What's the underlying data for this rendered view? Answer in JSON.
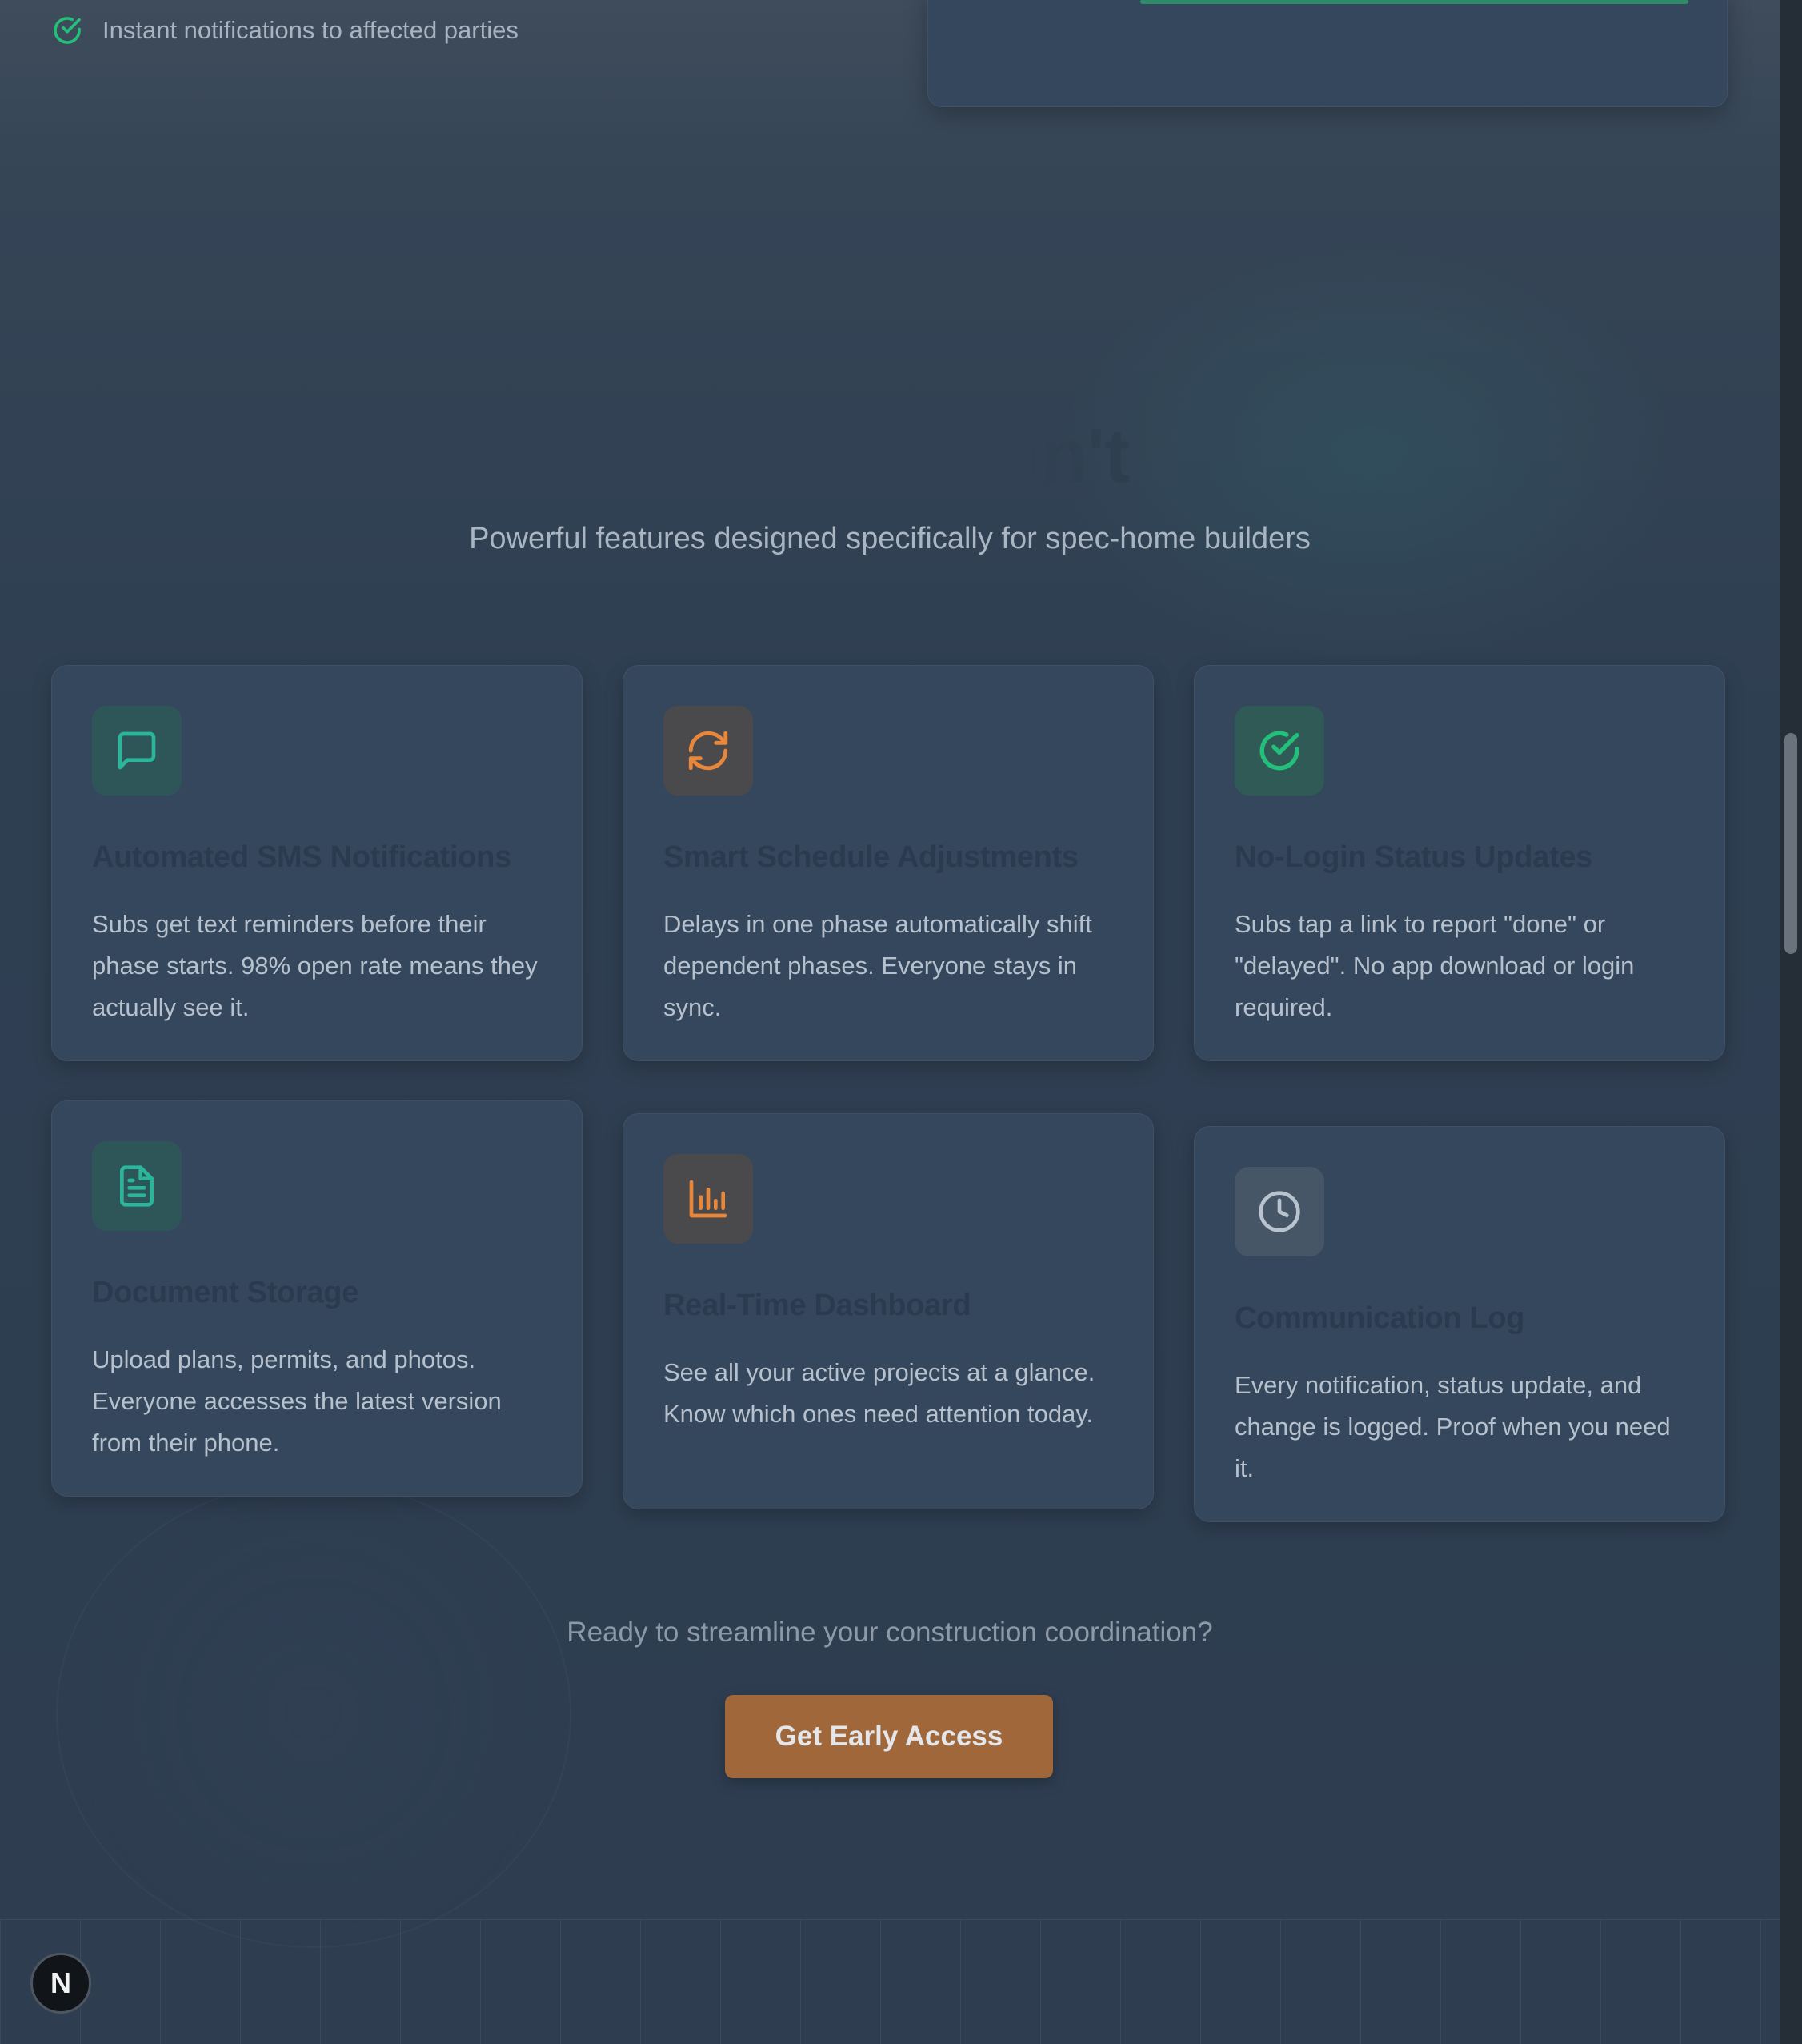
{
  "top": {
    "check_item": "Instant notifications to affected parties"
  },
  "features": {
    "title": "ing You Don't",
    "subtitle": "Powerful features designed specifically for spec-home builders",
    "cards": [
      {
        "icon": "message-icon",
        "title": "Automated SMS Notifications",
        "description": "Subs get text reminders before their phase starts. 98% open rate means they actually see it."
      },
      {
        "icon": "refresh-icon",
        "title": "Smart Schedule Adjustments",
        "description": "Delays in one phase automatically shift dependent phases. Everyone stays in sync."
      },
      {
        "icon": "check-circle-icon",
        "title": "No-Login Status Updates",
        "description": "Subs tap a link to report \"done\" or \"delayed\". No app download or login required."
      },
      {
        "icon": "document-icon",
        "title": "Document Storage",
        "description": "Upload plans, permits, and photos. Everyone accesses the latest version from their phone."
      },
      {
        "icon": "bar-chart-icon",
        "title": "Real-Time Dashboard",
        "description": "See all your active projects at a glance. Know which ones need attention today."
      },
      {
        "icon": "clock-icon",
        "title": "Communication Log",
        "description": "Every notification, status update, and change is logged. Proof when you need it."
      }
    ]
  },
  "cta": {
    "text": "Ready to streamline your construction coordination?",
    "button_label": "Get Early Access"
  },
  "badge": {
    "letter": "N"
  },
  "colors": {
    "teal_icon": "#2bb59a",
    "orange_icon": "#e8873a",
    "green_icon": "#22c07a",
    "gray_icon": "#b9c3cf",
    "cta_button": "#a0683a"
  }
}
